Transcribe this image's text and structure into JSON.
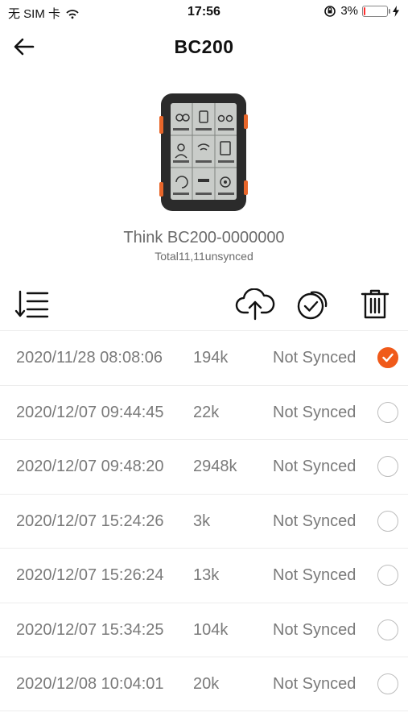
{
  "status_bar": {
    "carrier": "无 SIM 卡",
    "time": "17:56",
    "battery_percent_text": "3%",
    "battery_level": 0.03,
    "battery_color": "#ff2d2d",
    "icons": [
      "wifi-icon",
      "orientation-lock-icon",
      "charging-bolt-icon"
    ]
  },
  "nav": {
    "title": "BC200",
    "back_icon": "back-arrow-icon"
  },
  "device": {
    "name": "Think BC200-0000000",
    "summary": "Total11,11unsynced",
    "image_icon": "bike-computer-device-image"
  },
  "toolbar": {
    "items": [
      "sort-icon",
      "upload-cloud-icon",
      "sync-check-icon",
      "trash-icon"
    ]
  },
  "accent_color": "#f05a1a",
  "records": [
    {
      "date": "2020/11/28 08:08:06",
      "size": "194k",
      "status": "Not Synced",
      "selected": true
    },
    {
      "date": "2020/12/07 09:44:45",
      "size": "22k",
      "status": "Not Synced",
      "selected": false
    },
    {
      "date": "2020/12/07 09:48:20",
      "size": "2948k",
      "status": "Not Synced",
      "selected": false
    },
    {
      "date": "2020/12/07 15:24:26",
      "size": "3k",
      "status": "Not Synced",
      "selected": false
    },
    {
      "date": "2020/12/07 15:26:24",
      "size": "13k",
      "status": "Not Synced",
      "selected": false
    },
    {
      "date": "2020/12/07 15:34:25",
      "size": "104k",
      "status": "Not Synced",
      "selected": false
    },
    {
      "date": "2020/12/08 10:04:01",
      "size": "20k",
      "status": "Not Synced",
      "selected": false
    }
  ]
}
